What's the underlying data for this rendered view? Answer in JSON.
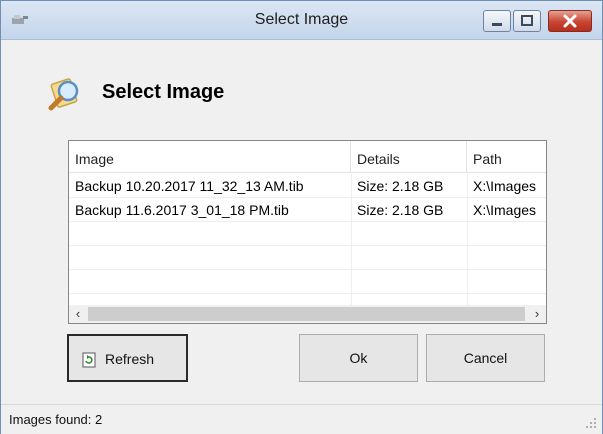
{
  "window": {
    "title": "Select Image"
  },
  "header": {
    "title": "Select Image",
    "icon": "magnifier-document-icon"
  },
  "list": {
    "columns": [
      "Image",
      "Details",
      "Path"
    ],
    "rows": [
      [
        "Backup 10.20.2017 11_32_13 AM.tib",
        "Size: 2.18 GB",
        "X:\\Images"
      ],
      [
        "Backup 11.6.2017 3_01_18 PM.tib",
        "Size: 2.18 GB",
        "X:\\Images"
      ]
    ]
  },
  "buttons": {
    "refresh": "Refresh",
    "ok": "Ok",
    "cancel": "Cancel"
  },
  "status": {
    "text": "Images found: 2"
  },
  "colors": {
    "titlebar": "#c4d5ea",
    "close_button": "#c84532",
    "window_bg": "#f0f0f0"
  }
}
